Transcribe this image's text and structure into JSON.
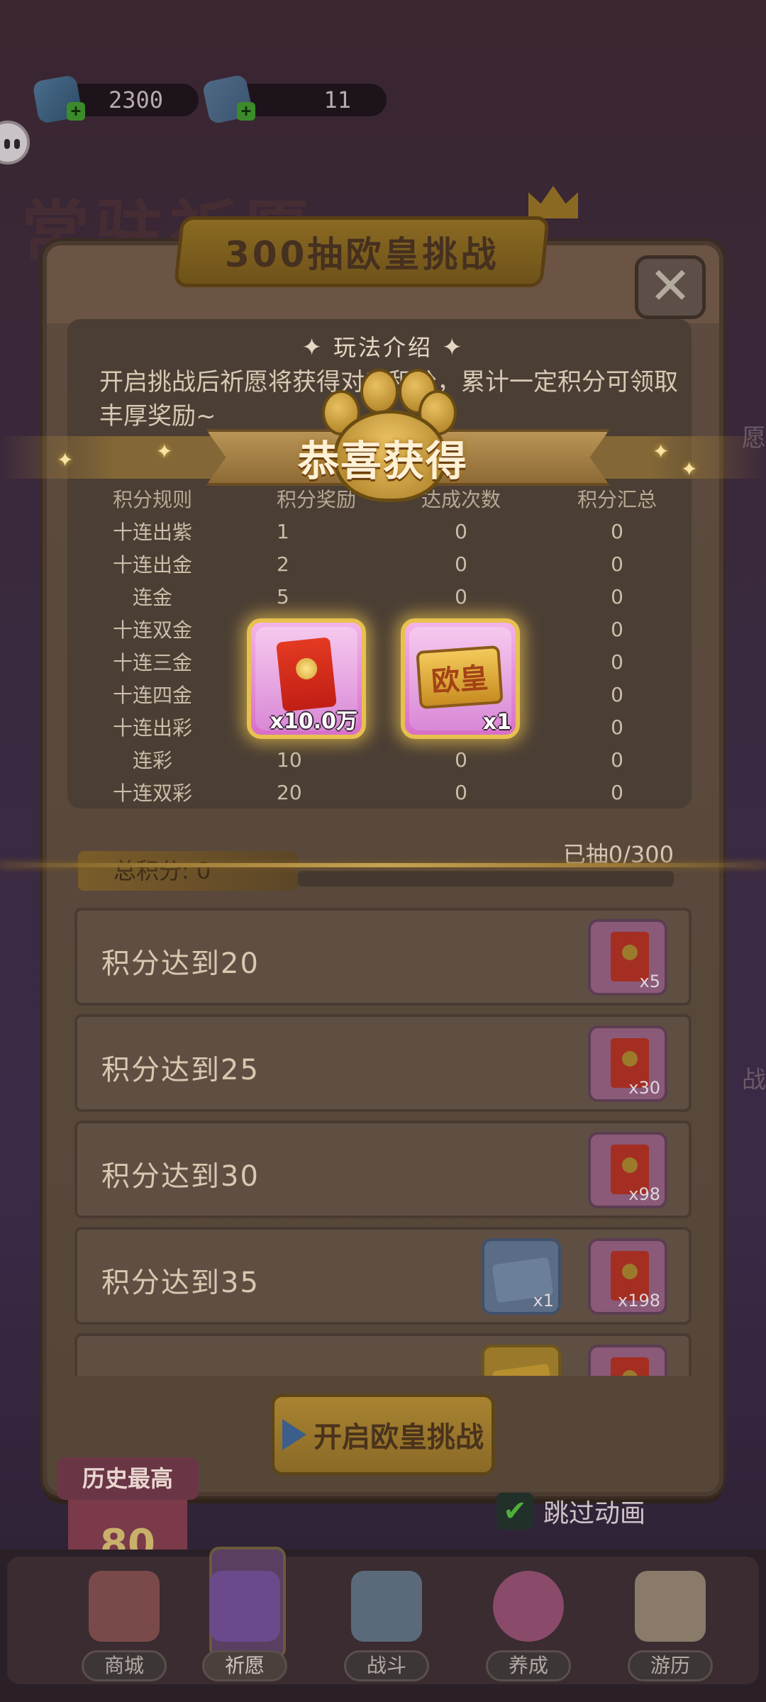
{
  "currencies": [
    {
      "icon": "gem-icon",
      "value": "2300"
    },
    {
      "icon": "ticket-icon",
      "value": "11"
    }
  ],
  "background": {
    "title": "常驻祈愿",
    "side_text_1": "愿",
    "side_text_2": "战"
  },
  "modal": {
    "title": "300抽欧皇挑战",
    "section_title": "玩法介绍",
    "description": "开启挑战后祈愿将获得对应积分，累计一定积分可领取丰厚奖励~",
    "table_headers": [
      "积分规则",
      "积分奖励",
      "达成次数",
      "积分汇总"
    ],
    "table_rows": [
      [
        "十连出紫",
        "1",
        "0",
        "0"
      ],
      [
        "十连出金",
        "2",
        "0",
        "0"
      ],
      [
        "连金",
        "5",
        "0",
        "0"
      ],
      [
        "十连双金",
        "",
        "",
        "0"
      ],
      [
        "十连三金",
        "",
        "",
        "0"
      ],
      [
        "十连四金",
        "",
        "",
        "0"
      ],
      [
        "十连出彩",
        "",
        "",
        "0"
      ],
      [
        "连彩",
        "10",
        "0",
        "0"
      ],
      [
        "十连双彩",
        "20",
        "0",
        "0"
      ]
    ],
    "total_label": "总积分: 0",
    "drawn_count": "已抽0/300",
    "draw_progress": 0,
    "reward_rows": [
      {
        "label": "积分达到20",
        "rewards": [
          {
            "type": "red-envelope",
            "qty": "x5"
          }
        ]
      },
      {
        "label": "积分达到25",
        "rewards": [
          {
            "type": "red-envelope",
            "qty": "x30"
          }
        ]
      },
      {
        "label": "积分达到30",
        "rewards": [
          {
            "type": "red-envelope",
            "qty": "x98"
          }
        ]
      },
      {
        "label": "积分达到35",
        "rewards": [
          {
            "type": "ticket",
            "qty": "x1"
          },
          {
            "type": "red-envelope",
            "qty": "x198"
          }
        ]
      },
      {
        "label": "",
        "rewards": [
          {
            "type": "gold-ticket",
            "qty": ""
          },
          {
            "type": "red-envelope",
            "qty": ""
          }
        ]
      }
    ],
    "start_button": "开启欧皇挑战",
    "skip_label": "跳过动画"
  },
  "history": {
    "label": "历史最高",
    "score": "80"
  },
  "nav": [
    {
      "label": "商城",
      "icon": "shop-icon"
    },
    {
      "label": "祈愿",
      "icon": "wish-card-icon",
      "active": true
    },
    {
      "label": "战斗",
      "icon": "crossed-swords-icon"
    },
    {
      "label": "养成",
      "icon": "paw-icon"
    },
    {
      "label": "游历",
      "icon": "map-icon"
    }
  ],
  "popup": {
    "title": "恭喜获得",
    "prizes": [
      {
        "type": "red-envelope",
        "qty": "x10.0万"
      },
      {
        "type": "ouhuang-card",
        "name": "欧皇",
        "qty": "x1"
      }
    ]
  }
}
